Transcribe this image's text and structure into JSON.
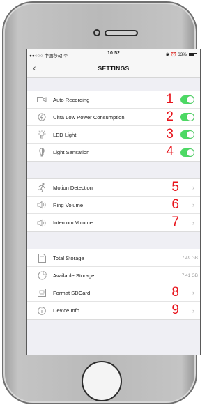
{
  "status_bar": {
    "carrier": "●●○○○ 中国移动 ᯤ",
    "time": "10:52",
    "battery_text": "◉ ⏰ 63%",
    "battery_level": 0.63
  },
  "nav": {
    "back_glyph": "‹",
    "title": "SETTINGS"
  },
  "colors": {
    "toggle_on": "#4cd964",
    "annotation": "#e8131b",
    "background": "#efeff4"
  },
  "groups": [
    {
      "items": [
        {
          "label": "Auto Recording",
          "icon": "camera-icon",
          "control": "toggle",
          "on": true,
          "annotation": "1"
        },
        {
          "label": "Ultra Low Power Consumption",
          "icon": "power-icon",
          "control": "toggle",
          "on": true,
          "annotation": "2"
        },
        {
          "label": "LED Light",
          "icon": "bulb-icon",
          "control": "toggle",
          "on": true,
          "annotation": "3"
        },
        {
          "label": "Light Sensation",
          "icon": "light-sensor-icon",
          "control": "toggle",
          "on": true,
          "annotation": "4"
        }
      ]
    },
    {
      "items": [
        {
          "label": "Motion Detection",
          "icon": "running-person-icon",
          "control": "chevron",
          "annotation": "5"
        },
        {
          "label": "Ring Volume",
          "icon": "speaker-icon",
          "control": "chevron",
          "annotation": "6"
        },
        {
          "label": "Intercom Volume",
          "icon": "speaker-icon",
          "control": "chevron",
          "annotation": "7"
        }
      ]
    },
    {
      "items": [
        {
          "label": "Total Storage",
          "icon": "sd-card-icon",
          "control": "value",
          "value": "7.49 GB"
        },
        {
          "label": "Available Storage",
          "icon": "pie-chart-icon",
          "control": "value",
          "value": "7.41 GB"
        },
        {
          "label": "Format SDCard",
          "icon": "format-icon",
          "control": "chevron",
          "annotation": "8"
        },
        {
          "label": "Device Info",
          "icon": "info-icon",
          "control": "chevron",
          "annotation": "9"
        }
      ]
    }
  ],
  "chevron_glyph": "›"
}
